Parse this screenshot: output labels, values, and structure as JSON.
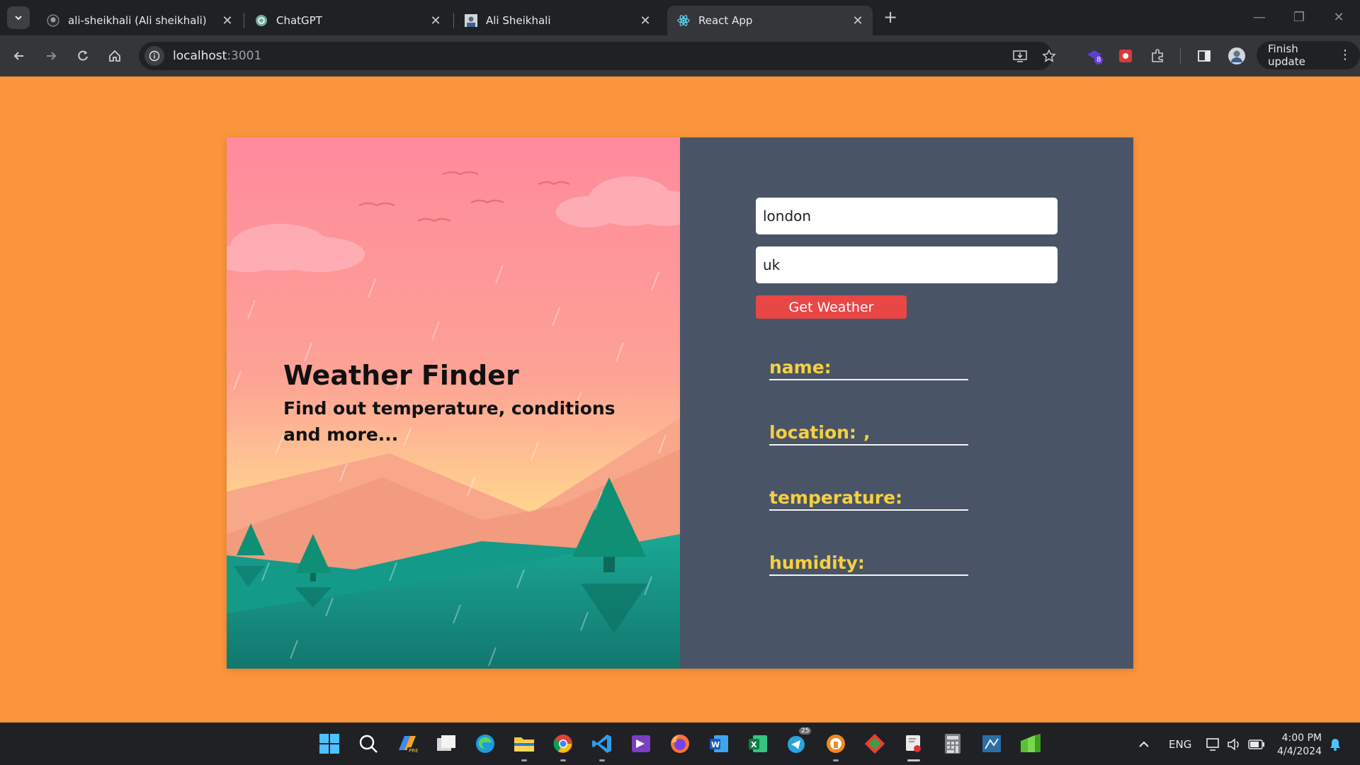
{
  "browser": {
    "tabs": [
      {
        "title": "ali-sheikhali (Ali sheikhali)",
        "favicon": "github-icon"
      },
      {
        "title": "ChatGPT",
        "favicon": "chatgpt-icon"
      },
      {
        "title": "Ali Sheikhali",
        "favicon": "profile-photo-icon"
      },
      {
        "title": "React App",
        "favicon": "react-icon",
        "active": true
      }
    ],
    "url_host": "localhost",
    "url_port": ":3001",
    "finish_update_label": "Finish update",
    "extension_badge": "8"
  },
  "app": {
    "title": "Weather Finder",
    "subtitle": "Find out temperature, conditions and more...",
    "city_value": "london",
    "country_value": "uk",
    "button_label": "Get Weather",
    "fields": {
      "name_label": "name:",
      "name_value": "",
      "location_label": "location:",
      "location_value": ",",
      "temperature_label": "temperature:",
      "temperature_value": "",
      "humidity_label": "humidity:",
      "humidity_value": ""
    }
  },
  "taskbar": {
    "telegram_badge": "25",
    "language": "ENG",
    "time": "4:00 PM",
    "date": "4/4/2024"
  },
  "colors": {
    "page_bg": "#fb953b",
    "right_panel": "#4a5467",
    "button": "#e94646",
    "label_yellow": "#f5d040"
  }
}
